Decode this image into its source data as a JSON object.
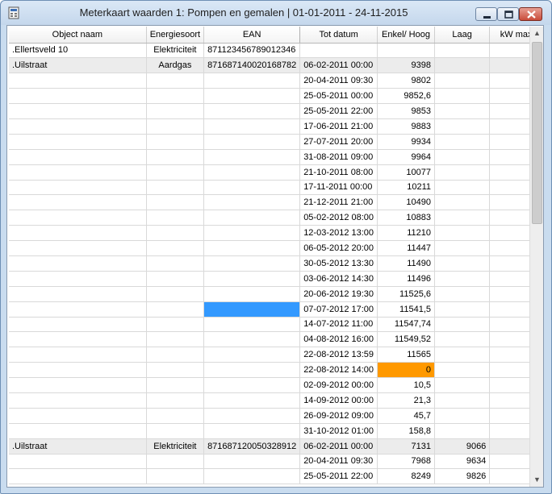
{
  "window": {
    "title": "Meterkaart waarden 1: Pompen en gemalen | 01-01-2011 - 24-11-2015",
    "accent_close": "#c94b3a"
  },
  "grid": {
    "columns": [
      "Object naam",
      "Energiesoort",
      "EAN",
      "Tot datum",
      "Enkel/ Hoog",
      "Laag",
      "kW max"
    ],
    "sorted_column": "EAN",
    "highlight_colors": {
      "selection": "#3399ff",
      "warning": "#ff9900"
    },
    "rows": [
      {
        "name": ".Ellertsveld 10",
        "type": "Elektriciteit",
        "ean": "871123456789012346",
        "date": "",
        "high": "",
        "low": "",
        "kw": "",
        "group": false
      },
      {
        "name": ".Uilstraat",
        "type": "Aardgas",
        "ean": "871687140020168782",
        "date": "06-02-2011 00:00",
        "high": "9398",
        "low": "",
        "kw": "",
        "group": true
      },
      {
        "name": "",
        "type": "",
        "ean": "",
        "date": "20-04-2011 09:30",
        "high": "9802",
        "low": "",
        "kw": ""
      },
      {
        "name": "",
        "type": "",
        "ean": "",
        "date": "25-05-2011 00:00",
        "high": "9852,6",
        "low": "",
        "kw": ""
      },
      {
        "name": "",
        "type": "",
        "ean": "",
        "date": "25-05-2011 22:00",
        "high": "9853",
        "low": "",
        "kw": ""
      },
      {
        "name": "",
        "type": "",
        "ean": "",
        "date": "17-06-2011 21:00",
        "high": "9883",
        "low": "",
        "kw": ""
      },
      {
        "name": "",
        "type": "",
        "ean": "",
        "date": "27-07-2011 20:00",
        "high": "9934",
        "low": "",
        "kw": ""
      },
      {
        "name": "",
        "type": "",
        "ean": "",
        "date": "31-08-2011 09:00",
        "high": "9964",
        "low": "",
        "kw": ""
      },
      {
        "name": "",
        "type": "",
        "ean": "",
        "date": "21-10-2011 08:00",
        "high": "10077",
        "low": "",
        "kw": ""
      },
      {
        "name": "",
        "type": "",
        "ean": "",
        "date": "17-11-2011 00:00",
        "high": "10211",
        "low": "",
        "kw": ""
      },
      {
        "name": "",
        "type": "",
        "ean": "",
        "date": "21-12-2011 21:00",
        "high": "10490",
        "low": "",
        "kw": ""
      },
      {
        "name": "",
        "type": "",
        "ean": "",
        "date": "05-02-2012 08:00",
        "high": "10883",
        "low": "",
        "kw": ""
      },
      {
        "name": "",
        "type": "",
        "ean": "",
        "date": "12-03-2012 13:00",
        "high": "11210",
        "low": "",
        "kw": ""
      },
      {
        "name": "",
        "type": "",
        "ean": "",
        "date": "06-05-2012 20:00",
        "high": "11447",
        "low": "",
        "kw": ""
      },
      {
        "name": "",
        "type": "",
        "ean": "",
        "date": "30-05-2012 13:30",
        "high": "11490",
        "low": "",
        "kw": ""
      },
      {
        "name": "",
        "type": "",
        "ean": "",
        "date": "03-06-2012 14:30",
        "high": "11496",
        "low": "",
        "kw": ""
      },
      {
        "name": "",
        "type": "",
        "ean": "",
        "date": "20-06-2012 19:30",
        "high": "11525,6",
        "low": "",
        "kw": ""
      },
      {
        "name": "",
        "type": "",
        "ean": "",
        "date": "07-07-2012 17:00",
        "high": "11541,5",
        "low": "",
        "kw": "",
        "ean_selected": true
      },
      {
        "name": "",
        "type": "",
        "ean": "",
        "date": "14-07-2012 11:00",
        "high": "11547,74",
        "low": "",
        "kw": ""
      },
      {
        "name": "",
        "type": "",
        "ean": "",
        "date": "04-08-2012 16:00",
        "high": "11549,52",
        "low": "",
        "kw": ""
      },
      {
        "name": "",
        "type": "",
        "ean": "",
        "date": "22-08-2012 13:59",
        "high": "11565",
        "low": "",
        "kw": ""
      },
      {
        "name": "",
        "type": "",
        "ean": "",
        "date": "22-08-2012 14:00",
        "high": "0",
        "low": "",
        "kw": "",
        "high_warning": true
      },
      {
        "name": "",
        "type": "",
        "ean": "",
        "date": "02-09-2012 00:00",
        "high": "10,5",
        "low": "",
        "kw": ""
      },
      {
        "name": "",
        "type": "",
        "ean": "",
        "date": "14-09-2012 00:00",
        "high": "21,3",
        "low": "",
        "kw": ""
      },
      {
        "name": "",
        "type": "",
        "ean": "",
        "date": "26-09-2012 09:00",
        "high": "45,7",
        "low": "",
        "kw": ""
      },
      {
        "name": "",
        "type": "",
        "ean": "",
        "date": "31-10-2012 01:00",
        "high": "158,8",
        "low": "",
        "kw": ""
      },
      {
        "name": ".Uilstraat",
        "type": "Elektriciteit",
        "ean": "871687120050328912",
        "date": "06-02-2011 00:00",
        "high": "7131",
        "low": "9066",
        "kw": "",
        "group": true
      },
      {
        "name": "",
        "type": "",
        "ean": "",
        "date": "20-04-2011 09:30",
        "high": "7968",
        "low": "9634",
        "kw": ""
      },
      {
        "name": "",
        "type": "",
        "ean": "",
        "date": "25-05-2011 22:00",
        "high": "8249",
        "low": "9826",
        "kw": ""
      }
    ]
  },
  "scrollbar": {
    "up_icon": "scroll-up-arrow",
    "down_icon": "scroll-down-arrow",
    "position_fraction": 0.0
  }
}
